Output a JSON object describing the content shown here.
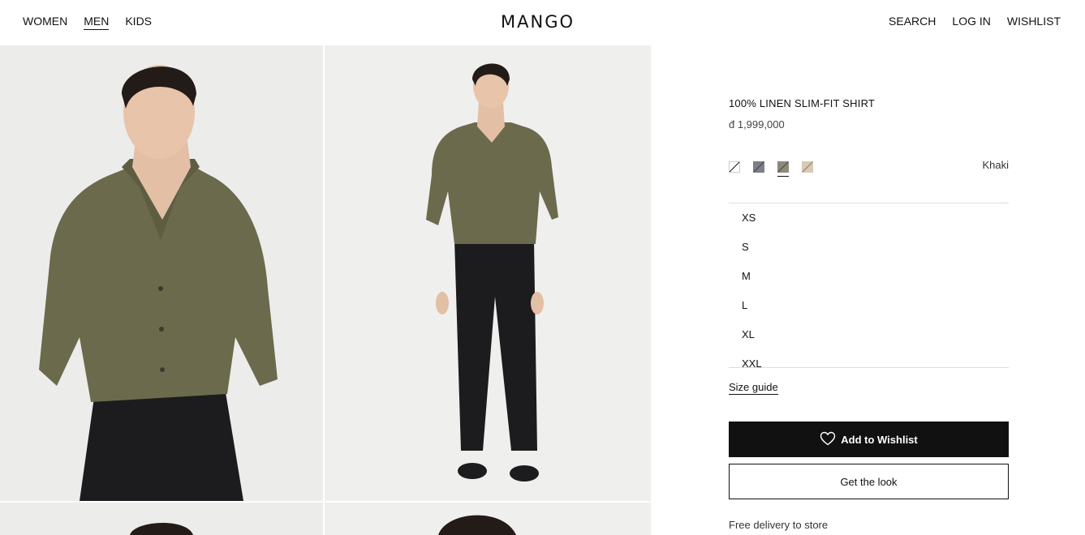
{
  "header": {
    "nav_left": [
      "WOMEN",
      "MEN",
      "KIDS"
    ],
    "active_nav": "MEN",
    "logo": "MANGO",
    "nav_right": [
      "SEARCH",
      "LOG IN",
      "WISHLIST"
    ]
  },
  "product": {
    "title": "100% LINEN SLIM-FIT SHIRT",
    "price": "đ 1,999,000",
    "selected_color": "Khaki",
    "swatches": [
      {
        "name": "white",
        "color": "#ffffff"
      },
      {
        "name": "grey",
        "color": "#7b7f86"
      },
      {
        "name": "khaki",
        "color": "#8d8a7c"
      },
      {
        "name": "beige",
        "color": "#d8c9b4"
      }
    ],
    "sizes": [
      "XS",
      "S",
      "M",
      "L",
      "XL",
      "XXL"
    ],
    "size_guide": "Size guide",
    "add_to_wishlist": "Add to Wishlist",
    "get_the_look": "Get the look",
    "delivery": "Free delivery to store"
  },
  "colors": {
    "shirt": "#6b6a4c",
    "pants": "#1c1c1e",
    "background": "#ececeb"
  }
}
